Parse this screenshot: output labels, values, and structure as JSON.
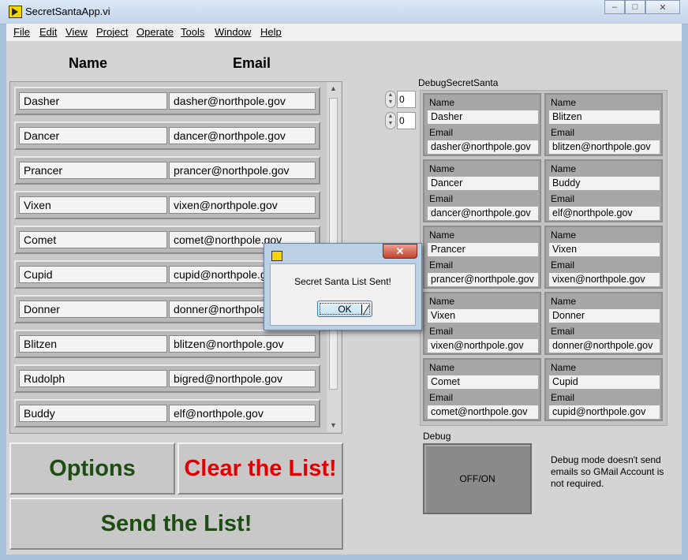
{
  "window": {
    "title": "SecretSantaApp.vi",
    "controls": {
      "minimize": "–",
      "maximize": "□",
      "close": "✕"
    }
  },
  "menu": [
    "File",
    "Edit",
    "View",
    "Project",
    "Operate",
    "Tools",
    "Window",
    "Help"
  ],
  "list": {
    "headers": {
      "name": "Name",
      "email": "Email"
    },
    "rows": [
      {
        "name": "Dasher",
        "email": "dasher@northpole.gov"
      },
      {
        "name": "Dancer",
        "email": "dancer@northpole.gov"
      },
      {
        "name": "Prancer",
        "email": "prancer@northpole.gov"
      },
      {
        "name": "Vixen",
        "email": "vixen@northpole.gov"
      },
      {
        "name": "Comet",
        "email": "comet@northpole.gov"
      },
      {
        "name": "Cupid",
        "email": "cupid@northpole.gov"
      },
      {
        "name": "Donner",
        "email": "donner@northpole.gov"
      },
      {
        "name": "Blitzen",
        "email": "blitzen@northpole.gov"
      },
      {
        "name": "Rudolph",
        "email": "bigred@northpole.gov"
      },
      {
        "name": "Buddy",
        "email": "elf@northpole.gov"
      }
    ]
  },
  "buttons": {
    "options": "Options",
    "clear": "Clear the List!",
    "send": "Send the List!"
  },
  "colors": {
    "options_text": "#1d4d12",
    "clear_text": "#e00000",
    "send_text": "#1d4d12"
  },
  "debug": {
    "title": "DebugSecretSanta",
    "index_row": "0",
    "index_col": "0",
    "name_label": "Name",
    "email_label": "Email",
    "pairs": [
      [
        {
          "name": "Dasher",
          "email": "dasher@northpole.gov"
        },
        {
          "name": "Blitzen",
          "email": "blitzen@northpole.gov"
        }
      ],
      [
        {
          "name": "Dancer",
          "email": "dancer@northpole.gov"
        },
        {
          "name": "Buddy",
          "email": "elf@northpole.gov"
        }
      ],
      [
        {
          "name": "Prancer",
          "email": "prancer@northpole.gov"
        },
        {
          "name": "Vixen",
          "email": "vixen@northpole.gov"
        }
      ],
      [
        {
          "name": "Vixen",
          "email": "vixen@northpole.gov"
        },
        {
          "name": "Donner",
          "email": "donner@northpole.gov"
        }
      ],
      [
        {
          "name": "Comet",
          "email": "comet@northpole.gov"
        },
        {
          "name": "Cupid",
          "email": "cupid@northpole.gov"
        }
      ]
    ],
    "toggle_label": "Debug",
    "toggle_text": "OFF/ON",
    "note": "Debug mode doesn't send emails so GMail Account is not required."
  },
  "dialog": {
    "message": "Secret Santa List Sent!",
    "ok": "OK",
    "close": "✕"
  }
}
